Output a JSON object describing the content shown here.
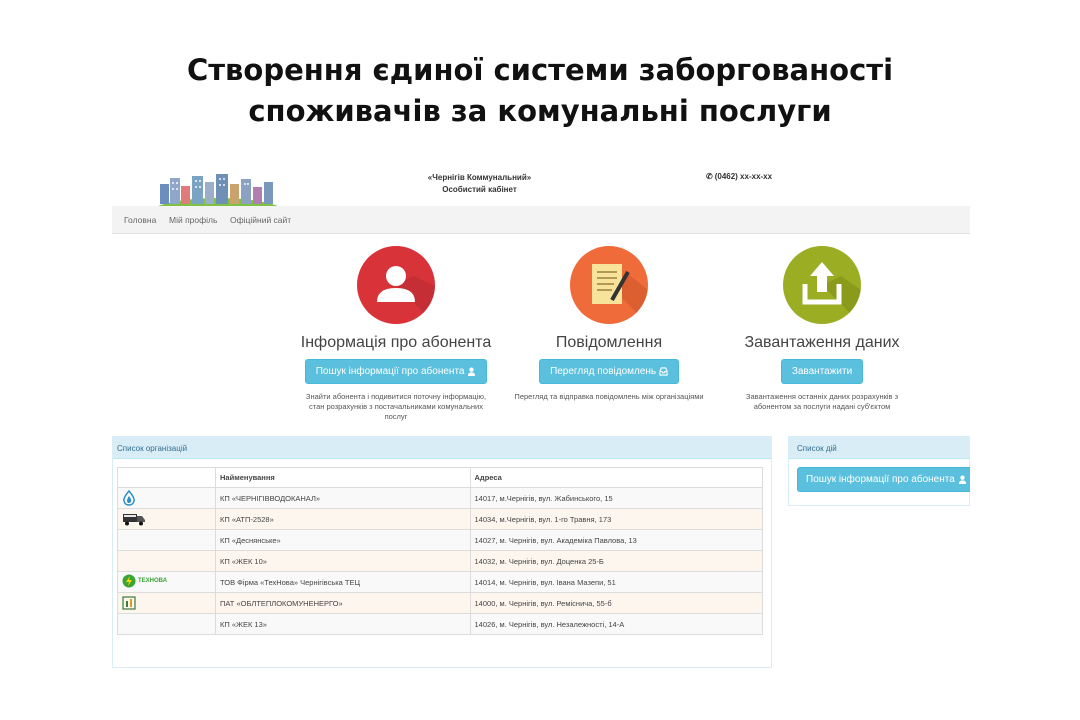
{
  "slide": {
    "title_line1": "Створення єдиної системи заборгованості",
    "title_line2": "споживачів за комунальні послуги"
  },
  "header": {
    "company_line1": "«Чернігів Коммунальний»",
    "company_line2": "Особистий кабінет",
    "phone": "(0462) xx-xx-xx",
    "phone_icon": "phone-icon"
  },
  "nav": {
    "items": [
      "Головна",
      "Мій профіль",
      "Офіційний сайт"
    ]
  },
  "features": [
    {
      "title": "Інформація про абонента",
      "button": "Пошук інформації про абонента",
      "button_icon": "user-icon",
      "description": "Знайти абонента і подивитися поточну інформацію, стан розрахунків з постачальниками комунальних послуг",
      "icon": "user-circle-icon",
      "color": "#d9333a"
    },
    {
      "title": "Повідомлення",
      "button": "Перегляд повідомлень",
      "button_icon": "inbox-icon",
      "description": "Перегляд та відправка повідомлень між організаціями",
      "icon": "document-pen-icon",
      "color": "#ef6b3a"
    },
    {
      "title": "Завантаження даних",
      "button": "Завантажити",
      "description": "Завантаження останніх даних розрахунків з абонентом за послуги надані суб'єктом",
      "icon": "upload-icon",
      "color": "#9aad23"
    }
  ],
  "organizations": {
    "panel_title": "Список організацій",
    "columns": [
      "",
      "Найменування",
      "Адреса"
    ],
    "rows": [
      {
        "logo": "water-drop-icon",
        "name": "КП «ЧЕРНІГІВВОДОКАНАЛ»",
        "address": "14017, м.Чернігів, вул. Жабинського, 15"
      },
      {
        "logo": "truck-icon",
        "name": "КП «АТП-2528»",
        "address": "14034, м.Чернігів, вул. 1-го Травня, 173"
      },
      {
        "logo": "",
        "name": "КП «Деснянське»",
        "address": "14027, м. Чернігів, вул. Академіка Павлова, 13"
      },
      {
        "logo": "",
        "name": "КП «ЖЕК 10»",
        "address": "14032, м. Чернігів, вул. Доценка 25-Б"
      },
      {
        "logo": "technova-logo",
        "logo_text": "ТЕХНОВА",
        "name": "ТОВ Фірма «ТехНова» Чернігівська ТЕЦ",
        "address": "14014, м. Чернігів, вул. Івана Мазепи, 51"
      },
      {
        "logo": "building-icon",
        "name": "ПАТ «ОБЛТЕПЛОКОМУНЕНЕРГО»",
        "address": "14000, м. Чернігів, вул. Ремісничa, 55-б"
      },
      {
        "logo": "",
        "name": "КП «ЖЕК 13»",
        "address": "14026, м. Чернігів, вул. Незалежності, 14-А"
      }
    ]
  },
  "actions": {
    "panel_title": "Список дій",
    "button": "Пошук інформації про абонента",
    "button_icon": "user-icon"
  }
}
